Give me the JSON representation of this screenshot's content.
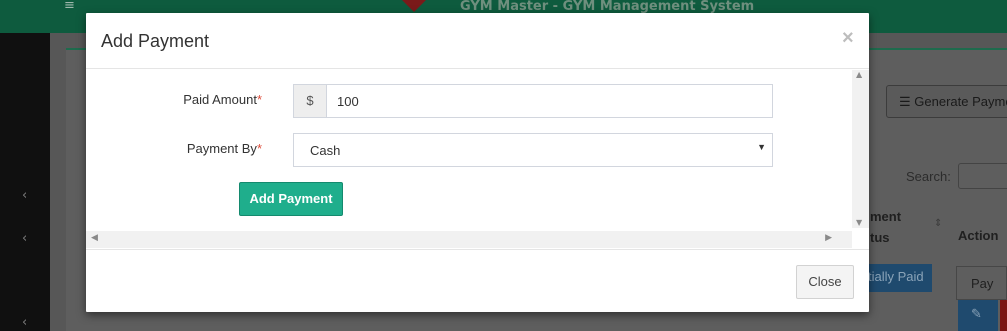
{
  "background": {
    "app_title": "GYM Master - GYM Management System",
    "generate_button_label": "Generate Payme",
    "search_label": "Search:",
    "table_header_status": "ment\ntus",
    "table_header_action": "Action",
    "status_badge": "tially Paid",
    "pay_button_label": "Pay"
  },
  "modal": {
    "title": "Add Payment",
    "close_x": "×",
    "fields": {
      "paid_amount": {
        "label": "Paid Amount",
        "required_mark": "*",
        "currency_symbol": "$",
        "value": "100"
      },
      "payment_by": {
        "label": "Payment By",
        "required_mark": "*",
        "selected": "Cash"
      }
    },
    "submit_label": "Add Payment",
    "close_label": "Close"
  },
  "colors": {
    "primary_button": "#1fae8c",
    "required": "#dd4b39",
    "topbar": "#0e5b3e"
  },
  "icons": {
    "menu": "hamburger-icon",
    "close": "close-icon",
    "dropdown": "caret-down-icon",
    "list": "list-icon",
    "edit": "edit-icon"
  }
}
